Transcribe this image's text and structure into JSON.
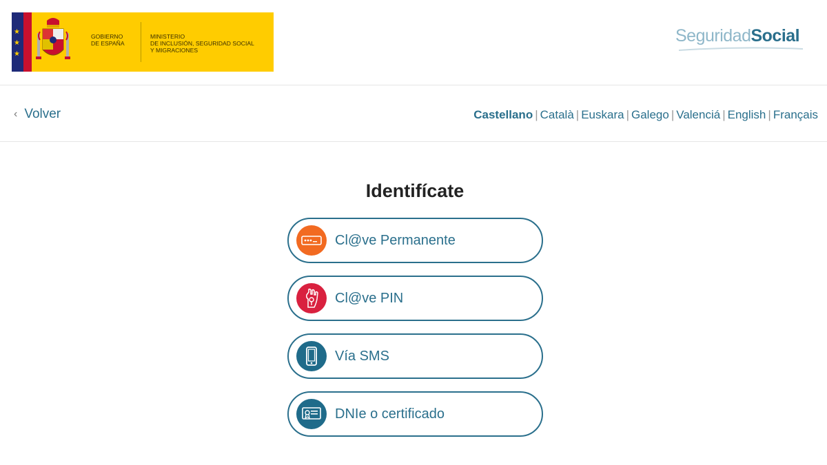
{
  "header": {
    "government": [
      "Gobierno",
      "de España"
    ],
    "ministry": [
      "Ministerio",
      "de Inclusión, Seguridad Social",
      "y Migraciones"
    ],
    "brand_light": "Seguridad",
    "brand_bold": "Social"
  },
  "nav": {
    "back_label": "Volver",
    "languages": [
      "Castellano",
      "Català",
      "Euskara",
      "Galego",
      "Valenciá",
      "English",
      "Français"
    ],
    "active_language": "Castellano"
  },
  "main": {
    "title": "Identifícate",
    "options": [
      {
        "label": "Cl@ve Permanente",
        "icon": "password-field-icon",
        "color": "#f26a21"
      },
      {
        "label": "Cl@ve PIN",
        "icon": "hand-key-icon",
        "color": "#d9213f"
      },
      {
        "label": "Vía SMS",
        "icon": "mobile-phone-icon",
        "color": "#1f6b8a"
      },
      {
        "label": "DNIe o certificado",
        "icon": "certificate-icon",
        "color": "#1f6b8a"
      }
    ]
  },
  "colors": {
    "accent": "#2a6f8c",
    "gov_yellow": "#ffcc00",
    "eu_blue": "#1e2a78",
    "gov_red": "#c8102e"
  }
}
